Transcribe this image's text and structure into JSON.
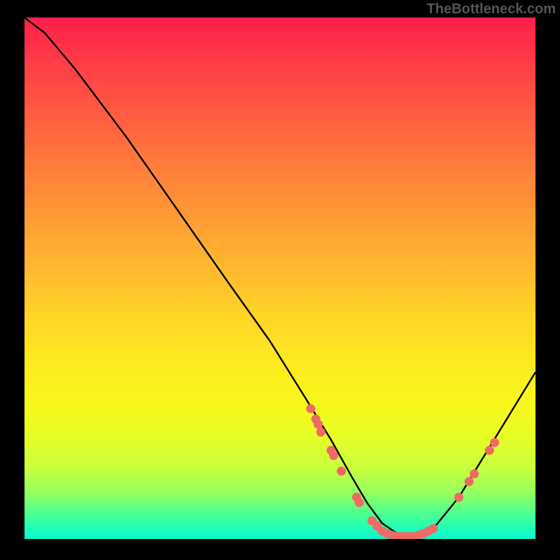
{
  "watermark": "TheBottleneck.com",
  "chart_data": {
    "type": "line",
    "title": "",
    "xlabel": "",
    "ylabel": "",
    "xlim": [
      0,
      100
    ],
    "ylim": [
      0,
      100
    ],
    "series": [
      {
        "name": "curve",
        "x": [
          0,
          4,
          10,
          20,
          30,
          40,
          48,
          55,
          60,
          64,
          67,
          70,
          73,
          76,
          80,
          85,
          90,
          95,
          100
        ],
        "y": [
          100,
          97,
          90,
          77,
          63,
          49,
          38,
          27,
          19,
          12,
          7,
          3,
          1,
          0.5,
          2,
          8,
          16,
          24,
          32
        ]
      }
    ],
    "markers": [
      {
        "x": 56,
        "y": 25
      },
      {
        "x": 57,
        "y": 23
      },
      {
        "x": 57.5,
        "y": 22
      },
      {
        "x": 58,
        "y": 20.5
      },
      {
        "x": 60,
        "y": 17
      },
      {
        "x": 60.5,
        "y": 16
      },
      {
        "x": 62,
        "y": 13
      },
      {
        "x": 65,
        "y": 8
      },
      {
        "x": 65.5,
        "y": 7
      },
      {
        "x": 68,
        "y": 3.5
      },
      {
        "x": 69,
        "y": 2.5
      },
      {
        "x": 70,
        "y": 1.5
      },
      {
        "x": 71,
        "y": 1
      },
      {
        "x": 72,
        "y": 0.7
      },
      {
        "x": 73,
        "y": 0.5
      },
      {
        "x": 74,
        "y": 0.5
      },
      {
        "x": 75,
        "y": 0.5
      },
      {
        "x": 76,
        "y": 0.5
      },
      {
        "x": 77,
        "y": 0.7
      },
      {
        "x": 78,
        "y": 1
      },
      {
        "x": 79,
        "y": 1.5
      },
      {
        "x": 80,
        "y": 2
      },
      {
        "x": 85,
        "y": 8
      },
      {
        "x": 87,
        "y": 11
      },
      {
        "x": 88,
        "y": 12.5
      },
      {
        "x": 91,
        "y": 17
      },
      {
        "x": 92,
        "y": 18.5
      }
    ],
    "marker_color": "#ee6b64",
    "curve_color": "#000000"
  }
}
